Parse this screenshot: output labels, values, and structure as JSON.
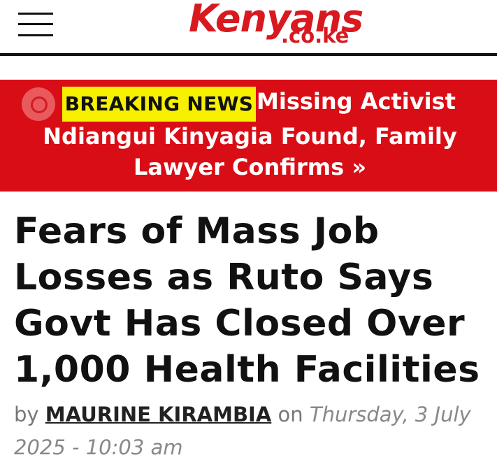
{
  "header": {
    "logo_main": "Kenyans",
    "logo_sub": ".co.ke",
    "colors": {
      "brand": "#d8191f",
      "rule": "#111111"
    }
  },
  "breaking": {
    "badge": "BREAKING NEWS",
    "line1": "Missing Activist",
    "line2": "Ndiangui Kinyagia Found, Family",
    "line3": "Lawyer Confirms »",
    "colors": {
      "bar": "#d90d15",
      "badge": "#f7f000"
    }
  },
  "article": {
    "title": "Fears of Mass Job Losses as Ruto Says Govt Has Closed Over 1,000 Health Facilities",
    "by": "by",
    "author": "MAURINE KIRAMBIA",
    "on": "on",
    "date": "Thursday, 3 July 2025 - 10:03 am"
  },
  "icons": {
    "menu": "hamburger-icon",
    "live": "live-record-icon"
  }
}
